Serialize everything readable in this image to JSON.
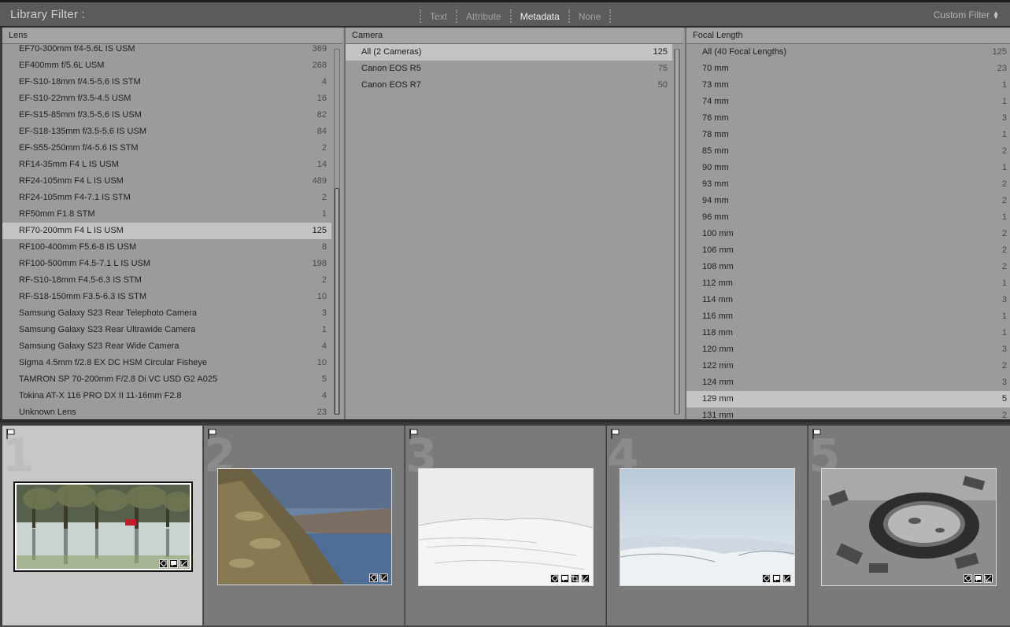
{
  "filter_bar": {
    "title": "Library Filter :",
    "modes": [
      "Text",
      "Attribute",
      "Metadata",
      "None"
    ],
    "active_mode": "Metadata",
    "custom_filter": "Custom Filter"
  },
  "lens": {
    "header": "Lens",
    "items": [
      {
        "label": "EF70-300mm f/4-5.6L IS USM",
        "count": "369"
      },
      {
        "label": "EF400mm f/5.6L USM",
        "count": "268"
      },
      {
        "label": "EF-S10-18mm f/4.5-5.6 IS STM",
        "count": "4"
      },
      {
        "label": "EF-S10-22mm f/3.5-4.5 USM",
        "count": "16"
      },
      {
        "label": "EF-S15-85mm f/3.5-5.6 IS USM",
        "count": "82"
      },
      {
        "label": "EF-S18-135mm f/3.5-5.6 IS USM",
        "count": "84"
      },
      {
        "label": "EF-S55-250mm f/4-5.6 IS STM",
        "count": "2"
      },
      {
        "label": "RF14-35mm F4 L IS USM",
        "count": "14"
      },
      {
        "label": "RF24-105mm F4 L IS USM",
        "count": "489"
      },
      {
        "label": "RF24-105mm F4-7.1 IS STM",
        "count": "2"
      },
      {
        "label": "RF50mm F1.8 STM",
        "count": "1"
      },
      {
        "label": "RF70-200mm F4 L IS USM",
        "count": "125"
      },
      {
        "label": "RF100-400mm F5.6-8 IS USM",
        "count": "8"
      },
      {
        "label": "RF100-500mm F4.5-7.1 L IS USM",
        "count": "198"
      },
      {
        "label": "RF-S10-18mm F4.5-6.3 IS STM",
        "count": "2"
      },
      {
        "label": "RF-S18-150mm F3.5-6.3 IS STM",
        "count": "10"
      },
      {
        "label": "Samsung Galaxy S23 Rear Telephoto Camera",
        "count": "3"
      },
      {
        "label": "Samsung Galaxy S23 Rear Ultrawide Camera",
        "count": "1"
      },
      {
        "label": "Samsung Galaxy S23 Rear Wide Camera",
        "count": "4"
      },
      {
        "label": "Sigma 4.5mm f/2.8 EX DC HSM Circular Fisheye",
        "count": "10"
      },
      {
        "label": "TAMRON SP 70-200mm F/2.8 Di VC USD G2 A025",
        "count": "5"
      },
      {
        "label": "Tokina AT-X 116 PRO DX II 11-16mm F2.8",
        "count": "4"
      },
      {
        "label": "Unknown Lens",
        "count": "23"
      }
    ],
    "selected_index": 11
  },
  "camera": {
    "header": "Camera",
    "items": [
      {
        "label": "All (2 Cameras)",
        "count": "125"
      },
      {
        "label": "Canon EOS R5",
        "count": "75"
      },
      {
        "label": "Canon EOS R7",
        "count": "50"
      }
    ],
    "selected_index": 0
  },
  "focal_length": {
    "header": "Focal Length",
    "items": [
      {
        "label": "All (40 Focal Lengths)",
        "count": "125"
      },
      {
        "label": "70 mm",
        "count": "23"
      },
      {
        "label": "73 mm",
        "count": "1"
      },
      {
        "label": "74 mm",
        "count": "1"
      },
      {
        "label": "76 mm",
        "count": "3"
      },
      {
        "label": "78 mm",
        "count": "1"
      },
      {
        "label": "85 mm",
        "count": "2"
      },
      {
        "label": "90 mm",
        "count": "1"
      },
      {
        "label": "93 mm",
        "count": "2"
      },
      {
        "label": "94 mm",
        "count": "2"
      },
      {
        "label": "96 mm",
        "count": "1"
      },
      {
        "label": "100 mm",
        "count": "2"
      },
      {
        "label": "106 mm",
        "count": "2"
      },
      {
        "label": "108 mm",
        "count": "2"
      },
      {
        "label": "112 mm",
        "count": "1"
      },
      {
        "label": "114 mm",
        "count": "3"
      },
      {
        "label": "116 mm",
        "count": "1"
      },
      {
        "label": "118 mm",
        "count": "1"
      },
      {
        "label": "120 mm",
        "count": "3"
      },
      {
        "label": "122 mm",
        "count": "2"
      },
      {
        "label": "124 mm",
        "count": "3"
      },
      {
        "label": "129 mm",
        "count": "5"
      },
      {
        "label": "131 mm",
        "count": "2"
      }
    ],
    "selected_index": 21
  },
  "grid": {
    "cells": [
      {
        "number": "1",
        "selected": true,
        "scene": "flooded-trees",
        "badges": [
          "keyword-badge-icon",
          "comment-badge-icon",
          "edit-badge-icon"
        ]
      },
      {
        "number": "2",
        "selected": false,
        "scene": "river-gorge",
        "badges": [
          "keyword-badge-icon",
          "edit-badge-icon"
        ]
      },
      {
        "number": "3",
        "selected": false,
        "scene": "snowy-hills",
        "badges": [
          "keyword-badge-icon",
          "comment-badge-icon",
          "crop-badge-icon",
          "edit-badge-icon"
        ]
      },
      {
        "number": "4",
        "selected": false,
        "scene": "snow-landscape",
        "badges": [
          "keyword-badge-icon",
          "comment-badge-icon",
          "edit-badge-icon"
        ]
      },
      {
        "number": "5",
        "selected": false,
        "scene": "tire-in-ruins",
        "badges": [
          "keyword-badge-icon",
          "comment-badge-icon",
          "edit-badge-icon"
        ]
      }
    ]
  },
  "colors": {
    "panel_bg": "#9b9b9b",
    "selected_row": "#c4c4c4",
    "grid_cell": "#7a7a7a",
    "grid_cell_selected": "#c7c7c7"
  }
}
